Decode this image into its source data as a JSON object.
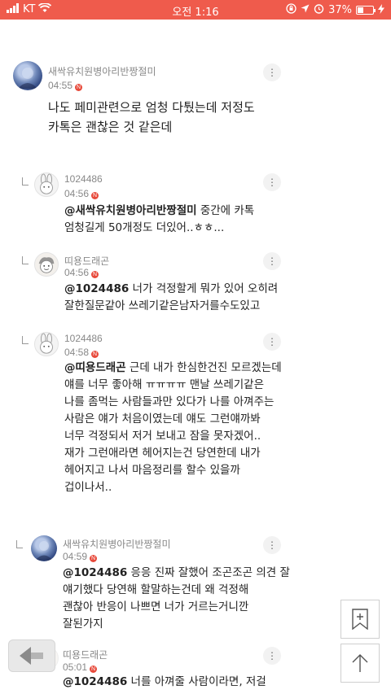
{
  "status_bar": {
    "carrier": "KT",
    "time": "오전 1:16",
    "battery": "37%",
    "battery_level": 0.37
  },
  "comments": [
    {
      "nick": "새싹유치원병아리반짱절미",
      "time": "04:55",
      "badge": "N",
      "mention": "",
      "text": "나도 페미관련으로 엄청 다퉜는데 저정도\n카톡은 괜찮은 것 같은데"
    },
    {
      "nick": "1024486",
      "time": "04:56",
      "badge": "N",
      "mention": "@새싹유치원병아리반짱절미",
      "text": " 중간에 카톡\n엄청길게 50개정도 더있어..ㅎㅎ..."
    },
    {
      "nick": "띠용드래곤",
      "time": "04:56",
      "badge": "N",
      "mention": "@1024486",
      "text": "  너가 걱정할게 뭐가 있어 오히려\n잘한질문같아 쓰레기같은남자거를수도있고"
    },
    {
      "nick": "1024486",
      "time": "04:58",
      "badge": "N",
      "mention": "@띠용드래곤",
      "text": " 근데 내가 한심한건진 모르겠는데\n얘를 너무 좋아해 ㅠㅠㅠㅠ 맨날 쓰레기같은\n나를 좀먹는 사람들과만 있다가 나를 아껴주는\n사람은 얘가 처음이였는데 얘도 그런얘까봐\n너무 걱정되서 저거 보내고 잠을 못자겠어..\n재가 그런애라면 헤어지는건 당연한데 내가\n헤어지고 나서 마음정리를 할수 있을까\n겁이나서.."
    },
    {
      "nick": "새싹유치원병아리반짱절미",
      "time": "04:59",
      "badge": "N",
      "mention": "@1024486",
      "text": "  응응 진짜 잘했어 조곤조곤 의견 잘\n얘기했다 당연해 할말하는건데 왜 걱정해\n괜찮아 반응이 나쁘면 너가 거르는거니깐\n잘된가지"
    },
    {
      "nick": "띠용드래곤",
      "time": "05:01",
      "badge": "N",
      "mention": "@1024486",
      "text": "  너를 아껴줄 사람이라면, 저걸"
    }
  ],
  "icons": {
    "more": "more-vertical-icon",
    "bookmark": "bookmark-add-icon",
    "scroll_top": "arrow-up-icon",
    "back": "back-arrow-icon"
  },
  "colors": {
    "status_bar": "#ef5b4c",
    "new_badge": "#e7493a"
  }
}
